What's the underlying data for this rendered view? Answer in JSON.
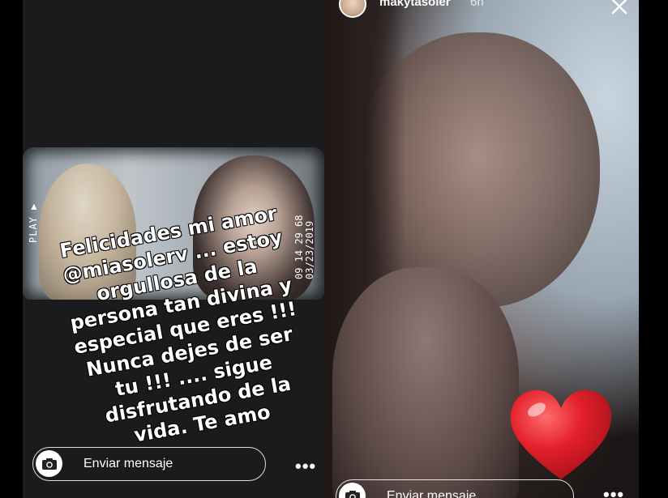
{
  "left_story": {
    "vhs": {
      "play_label": "PLAY ▶",
      "timestamp": "09 14 29 68",
      "date": "03/23/2019"
    },
    "caption_lines": [
      "Felicidades mi amor",
      "@miasolerv ... estoy",
      "orgullosa de la",
      "persona tan divina y",
      "especial que eres !!!",
      "Nunca dejes de ser",
      "tu !!! .... sigue",
      "disfrutando de la",
      "vida. Te amo"
    ],
    "message_placeholder": "Enviar mensaje",
    "more_label": "•••"
  },
  "right_story": {
    "username": "makytasoler",
    "time": "6h",
    "message_placeholder": "Enviar mensaje",
    "more_label": "•••",
    "sticker": "heart-sticker"
  },
  "colors": {
    "heart": "#e3202b",
    "text": "#ffffff",
    "panel_bg": "#1b1b1d"
  }
}
